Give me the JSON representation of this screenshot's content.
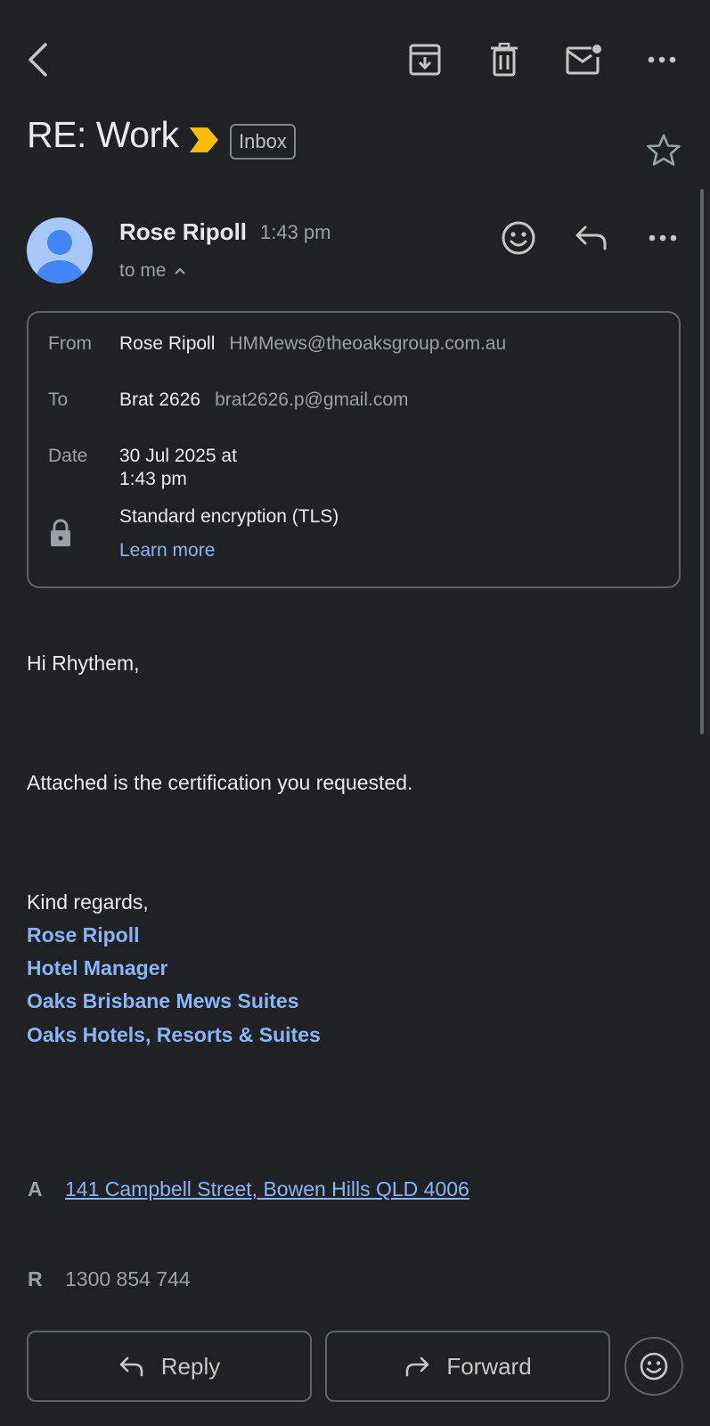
{
  "header": {
    "subject": "RE: Work",
    "label": "Inbox",
    "icons": [
      "back-arrow-icon",
      "archive-icon",
      "delete-icon",
      "mark-unread-icon",
      "more-icon",
      "star-icon"
    ]
  },
  "message": {
    "sender_name": "Rose Ripoll",
    "time": "1:43 pm",
    "recipient_summary": "to me"
  },
  "details": {
    "from_label": "From",
    "from_name": "Rose Ripoll",
    "from_email": "HMMews@theoaksgroup.com.au",
    "to_label": "To",
    "to_name": "Brat 2626",
    "to_email": "brat2626.p@gmail.com",
    "date_label": "Date",
    "date_line1": "30 Jul 2025 at",
    "date_line2": "1:43 pm",
    "encryption": "Standard encryption (TLS)",
    "learn_more": "Learn more"
  },
  "body": {
    "greeting": "Hi Rhythem,",
    "line1": "Attached is the certification you requested.",
    "closing": "Kind regards,",
    "signature": [
      "Rose Ripoll",
      "Hotel Manager",
      "Oaks Brisbane Mews Suites",
      "Oaks Hotels, Resorts & Suites"
    ],
    "address_key": "A",
    "address": "141 Campbell Street, Bowen Hills QLD 4006",
    "phone_key": "R",
    "phone": "1300 854 744"
  },
  "actions": {
    "reply": "Reply",
    "forward": "Forward"
  },
  "colors": {
    "background": "#202124",
    "link": "#8ab4f8",
    "label_tag": "#fbbc04",
    "avatar": "#a8c7fa",
    "avatar_figure": "#4285f4"
  }
}
